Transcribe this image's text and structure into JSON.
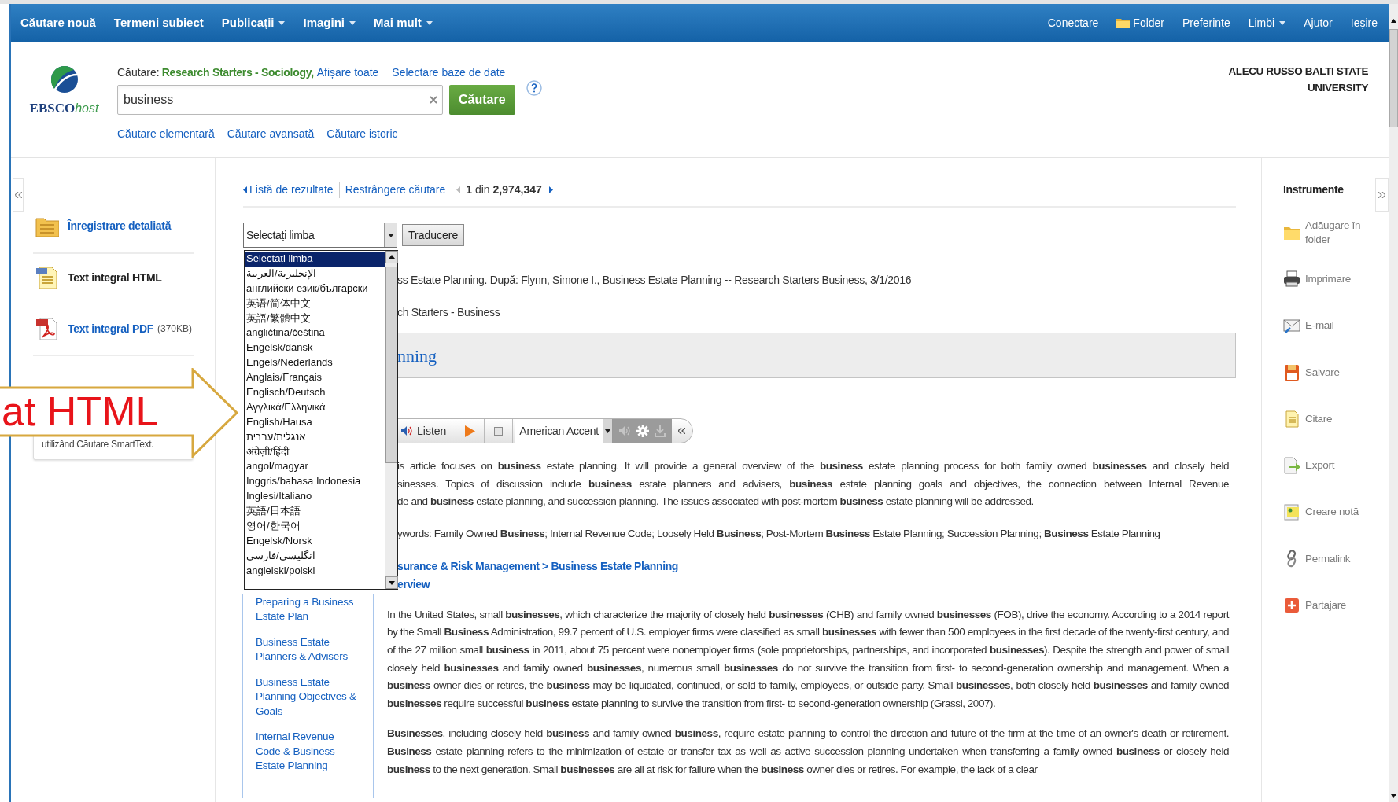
{
  "top_nav": {
    "left": [
      {
        "label": "Căutare nouă",
        "dropdown": false
      },
      {
        "label": "Termeni subiect",
        "dropdown": false
      },
      {
        "label": "Publicații",
        "dropdown": true
      },
      {
        "label": "Imagini",
        "dropdown": true
      },
      {
        "label": "Mai mult",
        "dropdown": true
      }
    ],
    "right": [
      {
        "label": "Conectare",
        "kind": "link",
        "dropdown": false
      },
      {
        "label": "Folder",
        "kind": "folder",
        "dropdown": false
      },
      {
        "label": "Preferințe",
        "kind": "link",
        "dropdown": false
      },
      {
        "label": "Limbi",
        "kind": "link",
        "dropdown": true
      },
      {
        "label": "Ajutor",
        "kind": "link",
        "dropdown": false
      },
      {
        "label": "Ieșire",
        "kind": "link",
        "dropdown": false
      }
    ]
  },
  "logo": {
    "brand": "EBSCO",
    "suffix": "host"
  },
  "search": {
    "label": "Căutare:",
    "databases": "Research Starters - Sociology,",
    "show_all": "Afișare toate",
    "select_databases": "Selectare baze de date",
    "value": "business",
    "button": "Căutare",
    "links": [
      "Căutare elementară",
      "Căutare avansată",
      "Căutare istoric"
    ]
  },
  "institution": "ALECU RUSSO BALTI STATE UNIVERSITY",
  "left_panel": {
    "items": [
      {
        "label": "Înregistrare detaliată",
        "kind": "record",
        "current": false
      },
      {
        "label": "Text integral HTML",
        "kind": "html",
        "current": true
      },
      {
        "label": "Text integral PDF",
        "kind": "pdf",
        "current": false,
        "size": "(370KB)"
      }
    ],
    "note": "utilizând Căutare SmartText."
  },
  "callout": {
    "text": "at HTML"
  },
  "result_nav": {
    "back": "Listă de rezultate",
    "refine": "Restrângere căutare",
    "position": "**1** din **2,974,347**"
  },
  "translate": {
    "value": "Selectați limba",
    "button": "Traducere",
    "options": [
      {
        "label": "Selectați limba",
        "selected": true
      },
      {
        "label": "الإنجليزية/العربية",
        "selected": false
      },
      {
        "label": "английски език/български",
        "selected": false
      },
      {
        "label": "英语/简体中文",
        "selected": false
      },
      {
        "label": "英語/繁體中文",
        "selected": false
      },
      {
        "label": "angličtina/čeština",
        "selected": false
      },
      {
        "label": "Engelsk/dansk",
        "selected": false
      },
      {
        "label": "Engels/Nederlands",
        "selected": false
      },
      {
        "label": "Anglais/Français",
        "selected": false
      },
      {
        "label": "Englisch/Deutsch",
        "selected": false
      },
      {
        "label": "Αγγλικά/Ελληνικά",
        "selected": false
      },
      {
        "label": "English/Hausa",
        "selected": false
      },
      {
        "label": "אנגלית/עברית",
        "selected": false
      },
      {
        "label": "अंग्रेज़ी/हिंदी",
        "selected": false
      },
      {
        "label": "angol/magyar",
        "selected": false
      },
      {
        "label": "Inggris/bahasa Indonesia",
        "selected": false
      },
      {
        "label": "Inglesi/Italiano",
        "selected": false
      },
      {
        "label": "英語/日本語",
        "selected": false
      },
      {
        "label": "영어/한국어",
        "selected": false
      },
      {
        "label": "Engelsk/Norsk",
        "selected": false
      },
      {
        "label": "انگلیسی/فارسی",
        "selected": false
      },
      {
        "label": "angielski/polski",
        "selected": false
      }
    ]
  },
  "citation": [
    "ss Estate Planning. După: Flynn, Simone I., Business Estate Planning -- Research Starters Business, 3/1/2016",
    "ch Starters - Business"
  ],
  "title": "nning",
  "listen": {
    "label": "Listen",
    "accent": "American Accent"
  },
  "abstract_lines": [
    "is article focuses on **business** estate planning. It will provide a general overview of the **business** estate planning process for both family owned **businesses** and closely held",
    "sinesses. Topics of discussion include **business** estate planners and advisers, **business** estate planning goals and objectives, the connection between Internal Revenue",
    "de and **business** estate planning, and succession planning. The issues associated with post-mortem **business** estate planning will be addressed."
  ],
  "keywords": "ywords: Family Owned **Business**; Internal Revenue Code; Loosely Held **Business**; Post-Mortem **Business** Estate Planning; Succession Planning; **Business** Estate Planning",
  "subject_path": "surance & Risk Management > Business Estate Planning",
  "section_link": "erview",
  "toc": [
    "Preparing a Business Estate Plan",
    "Business Estate Planners & Advisers",
    "Business Estate Planning Objectives & Goals",
    "Internal Revenue Code & Business Estate Planning"
  ],
  "body": [
    "In the United States, small **businesses**, which characterize the majority of closely held **businesses** (CHB) and family owned **businesses** (FOB), drive the economy. According to a 2014 report by the Small **Business** Administration, 99.7 percent of U.S. employer firms were classified as small **businesses** with fewer than 500 employees in the first decade of the twenty-first century, and of the 27 million small **business** in 2011, about 75 percent were nonemployer firms (sole proprietorships, partnerships, and incorporated **businesses**). Despite the strength and power of small closely held **businesses** and family owned **businesses**, numerous small **businesses** do not survive the transition from first- to second-generation ownership and management. When a **business** owner dies or retires, the **business** may be liquidated, continued, or sold to family, employees, or outside party. Small **businesses**, both closely held **businesses** and family owned **businesses** require successful **business** estate planning to survive the transition from first- to second-generation ownership (Grassi, 2007).",
    "**Businesses**, including closely held **business** and family owned **business**, require estate planning to control the direction and future of the firm at the time of an owner's death or retirement. **Business** estate planning refers to the minimization of estate or transfer tax as well as active succession planning undertaken when transferring a family owned **business** or closely held **business** to the next generation. Small **businesses** are all at risk for failure when the **business** owner dies or retires. For example, the lack of a clear"
  ],
  "tools": {
    "title": "Instrumente",
    "items": [
      {
        "label": "Adăugare în folder",
        "kind": "folder"
      },
      {
        "label": "Imprimare",
        "kind": "print"
      },
      {
        "label": "E-mail",
        "kind": "email"
      },
      {
        "label": "Salvare",
        "kind": "save"
      },
      {
        "label": "Citare",
        "kind": "cite"
      },
      {
        "label": "Export",
        "kind": "export"
      },
      {
        "label": "Creare notă",
        "kind": "note"
      },
      {
        "label": "Permalink",
        "kind": "link"
      },
      {
        "label": "Partajare",
        "kind": "share"
      }
    ]
  }
}
